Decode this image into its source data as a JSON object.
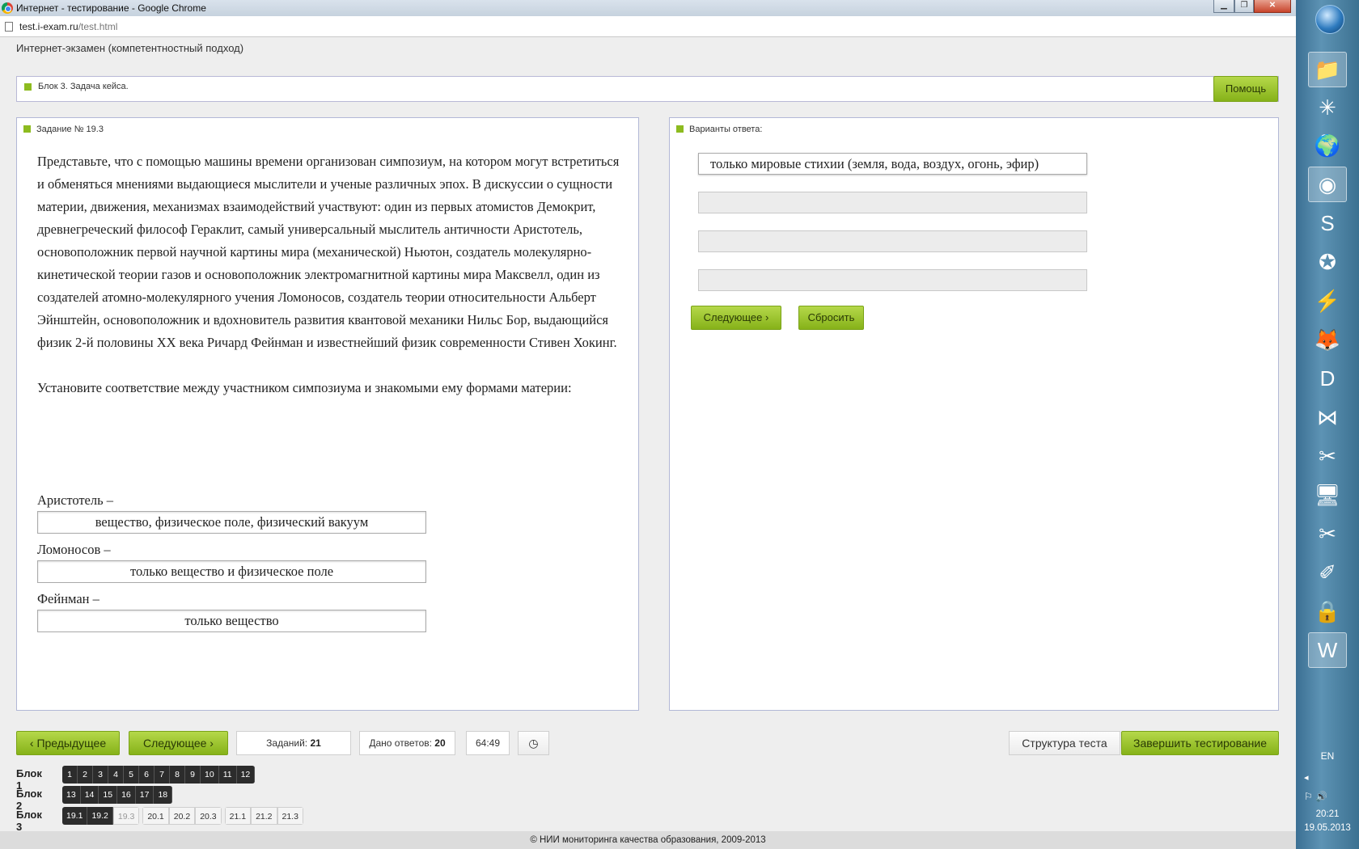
{
  "window": {
    "title": "Интернет - тестирование - Google Chrome",
    "minimize_glyph": "▁",
    "maximize_glyph": "❐",
    "close_glyph": "✕"
  },
  "address": {
    "host": "test.i-exam.ru",
    "path": "/test.html"
  },
  "app_header": "Интернет-экзамен (компетентностный подход)",
  "block_bar": {
    "label": "Блок 3. Задача кейса.",
    "help_button": "Помощь"
  },
  "task": {
    "heading": "Задание № 19.3",
    "paragraph1": "Представьте, что с помощью машины времени организован симпозиум, на котором могут встретиться и обменяться мнениями выдающиеся мыслители и ученые различных эпох. В дискуссии о сущности материи, движения, механизмах взаимодействий участвуют: один из первых атомистов Демокрит, древнегреческий философ Гераклит, самый универсальный мыслитель античности Аристотель, основоположник первой научной картины мира (механической) Ньютон, создатель молекулярно-кинетической теории газов и основоположник электромагнитной картины мира Максвелл, один из создателей атомно-молекулярного учения Ломоносов, создатель теории относительности Альберт Эйнштейн, основоположник и вдохновитель развития квантовой механики Нильс Бор, выдающийся физик 2-й половины XX века Ричард Фейнман и известнейший физик современности Стивен Хокинг.",
    "paragraph2": "Установите соответствие между участником симпозиума и знакомыми ему формами материи:",
    "matches": [
      {
        "label": "Аристотель –",
        "answer": "вещество, физическое поле, физический вакуум"
      },
      {
        "label": "Ломоносов –",
        "answer": "только вещество и физическое поле"
      },
      {
        "label": "Фейнман –",
        "answer": "только вещество"
      }
    ]
  },
  "answers": {
    "heading": "Варианты ответа:",
    "options": [
      "только мировые стихии (земля, вода, воздух, огонь, эфир)",
      "",
      "",
      ""
    ],
    "next_button": "Следующее",
    "reset_button": "Сбросить"
  },
  "nav": {
    "prev_button": "Предыдущее",
    "next_button": "Следующее",
    "tasks_label": "Заданий:",
    "tasks_count": "21",
    "answered_label": "Дано ответов:",
    "answered_count": "20",
    "timer": "64:49",
    "clock_glyph": "◷",
    "structure_button": "Структура теста",
    "finish_button": "Завершить тестирование"
  },
  "blocks": [
    {
      "label": "Блок 1",
      "items": [
        "1",
        "2",
        "3",
        "4",
        "5",
        "6",
        "7",
        "8",
        "9",
        "10",
        "11",
        "12"
      ]
    },
    {
      "label": "Блок 2",
      "items": [
        "13",
        "14",
        "15",
        "16",
        "17",
        "18"
      ]
    },
    {
      "label": "Блок 3",
      "items": [
        "19.1",
        "19.2",
        "19.3",
        "20.1",
        "20.2",
        "20.3",
        "21.1",
        "21.2",
        "21.3"
      ]
    }
  ],
  "footer": "© НИИ мониторинга качества образования, 2009-2013",
  "taskbar": {
    "lang": "EN",
    "tray": "◂",
    "tray_icons": "⚐ 🔊",
    "time": "20:21",
    "date": "19.05.2013",
    "icons": [
      "📁",
      "✳",
      "🌍",
      "◉",
      "S",
      "✪",
      "⚡",
      "🦊",
      "D",
      "⋈",
      "✂",
      "🖥",
      "✂",
      "✐",
      "🔒",
      "W"
    ]
  },
  "colors": {
    "accent_green": "#8dbb1f",
    "panel_border": "#b2b8d6"
  }
}
